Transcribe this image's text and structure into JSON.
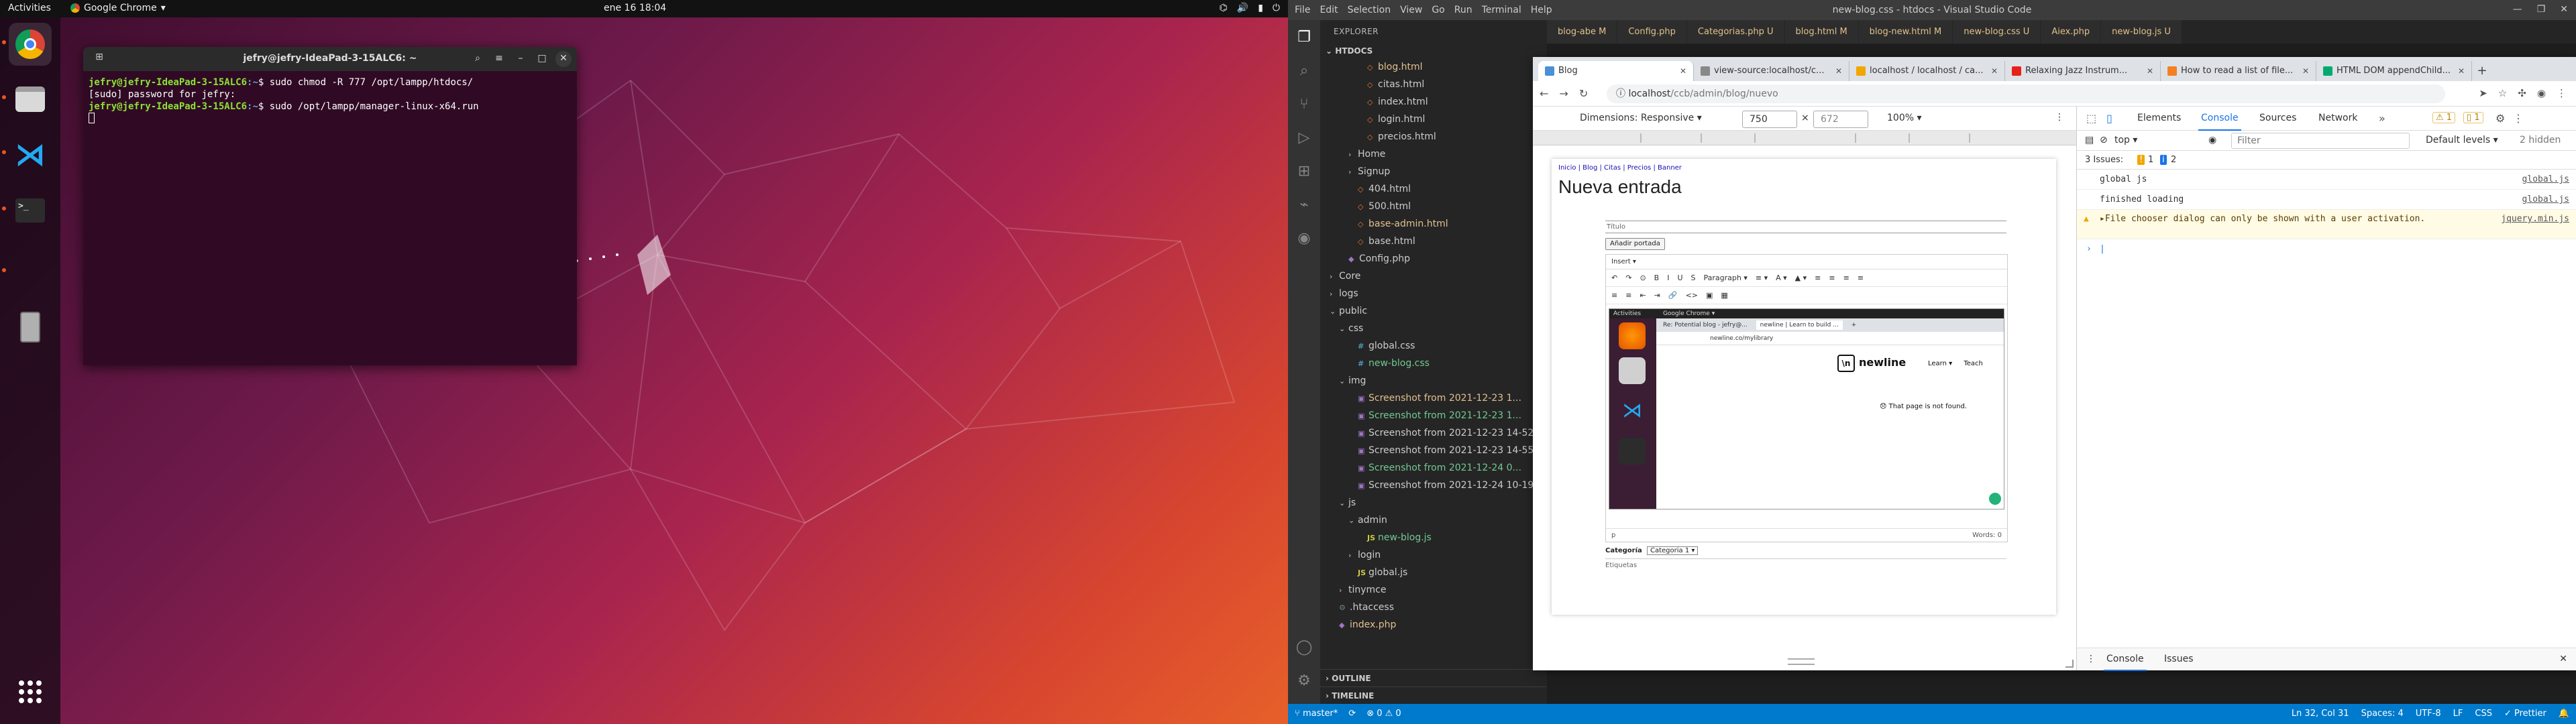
{
  "desktop": {
    "topbar": {
      "activities": "Activities",
      "app_name": "Google Chrome",
      "clock": "ene 16  18:04"
    },
    "terminal": {
      "title": "jefry@jefry-IdeaPad-3-15ALC6: ~",
      "lines": [
        {
          "user": "jefry@jefry-IdeaPad-3-15ALC6",
          "path": ":~",
          "cmd": "$ sudo chmod -R 777 /opt/lampp/htdocs/"
        },
        {
          "plain": "[sudo] password for jefry:"
        },
        {
          "user": "jefry@jefry-IdeaPad-3-15ALC6",
          "path": ":~",
          "cmd": "$ sudo /opt/lampp/manager-linux-x64.run"
        }
      ]
    }
  },
  "vscode": {
    "menu": [
      "File",
      "Edit",
      "Selection",
      "View",
      "Go",
      "Run",
      "Terminal",
      "Help"
    ],
    "window_title": "new-blog.css - htdocs - Visual Studio Code",
    "explorer_header": "EXPLORER",
    "root": "HTDOCS",
    "tree": [
      {
        "name": "blog.html",
        "depth": 3,
        "kind": "html",
        "status": "M",
        "cls": "mod"
      },
      {
        "name": "citas.html",
        "depth": 3,
        "kind": "html"
      },
      {
        "name": "index.html",
        "depth": 3,
        "kind": "html"
      },
      {
        "name": "login.html",
        "depth": 3,
        "kind": "html"
      },
      {
        "name": "precios.html",
        "depth": 3,
        "kind": "html"
      },
      {
        "name": "Home",
        "depth": 2,
        "kind": "folder"
      },
      {
        "name": "Signup",
        "depth": 2,
        "kind": "folder"
      },
      {
        "name": "404.html",
        "depth": 2,
        "kind": "html"
      },
      {
        "name": "500.html",
        "depth": 2,
        "kind": "html"
      },
      {
        "name": "base-admin.html",
        "depth": 2,
        "kind": "html",
        "status": "M",
        "cls": "mod"
      },
      {
        "name": "base.html",
        "depth": 2,
        "kind": "html"
      },
      {
        "name": "Config.php",
        "depth": 1,
        "kind": "php"
      },
      {
        "name": "Core",
        "depth": 0,
        "kind": "folder"
      },
      {
        "name": "logs",
        "depth": 0,
        "kind": "folder"
      },
      {
        "name": "public",
        "depth": 0,
        "kind": "folder-open"
      },
      {
        "name": "css",
        "depth": 1,
        "kind": "folder-open"
      },
      {
        "name": "global.css",
        "depth": 2,
        "kind": "css"
      },
      {
        "name": "new-blog.css",
        "depth": 2,
        "kind": "css",
        "status": "U",
        "cls": "untr"
      },
      {
        "name": "img",
        "depth": 1,
        "kind": "folder-open"
      },
      {
        "name": "Screenshot from 2021-12-23 1...",
        "depth": 2,
        "kind": "img",
        "status": "M",
        "cls": "mod"
      },
      {
        "name": "Screenshot from 2021-12-23 1...",
        "depth": 2,
        "kind": "img",
        "status": "U",
        "cls": "untr"
      },
      {
        "name": "Screenshot from 2021-12-23 14-52-...",
        "depth": 2,
        "kind": "img"
      },
      {
        "name": "Screenshot from 2021-12-23 14-55-...",
        "depth": 2,
        "kind": "img"
      },
      {
        "name": "Screenshot from 2021-12-24 0...",
        "depth": 2,
        "kind": "img",
        "status": "U",
        "cls": "untr"
      },
      {
        "name": "Screenshot from 2021-12-24 10-19-...",
        "depth": 2,
        "kind": "img"
      },
      {
        "name": "js",
        "depth": 1,
        "kind": "folder-open"
      },
      {
        "name": "admin",
        "depth": 2,
        "kind": "folder-open"
      },
      {
        "name": "new-blog.js",
        "depth": 3,
        "kind": "js",
        "status": "U",
        "cls": "untr"
      },
      {
        "name": "login",
        "depth": 2,
        "kind": "folder"
      },
      {
        "name": "global.js",
        "depth": 2,
        "kind": "js"
      },
      {
        "name": "tinymce",
        "depth": 1,
        "kind": "folder"
      },
      {
        "name": ".htaccess",
        "depth": 0,
        "kind": "dot"
      },
      {
        "name": "index.php",
        "depth": 0,
        "kind": "php",
        "status": "M",
        "cls": "mod"
      }
    ],
    "outline": "OUTLINE",
    "timeline": "TIMELINE",
    "editor_tabs": [
      "blog-abe M",
      "Config.php",
      "Categorias.php U",
      "blog.html M",
      "blog-new.html M",
      "new-blog.css U",
      "Aiex.php",
      "new-blog.js U"
    ],
    "status_bar": {
      "branch": "master*",
      "sync": "⟳",
      "problems": "⊗ 0 ⚠ 0",
      "position": "Ln 32, Col 31",
      "spaces": "Spaces: 4",
      "encoding": "UTF-8",
      "eol": "LF",
      "language": "CSS",
      "formatter": "✓ Prettier"
    }
  },
  "chrome": {
    "tabs": [
      {
        "title": "Blog",
        "active": true,
        "fav": "#4a90d9"
      },
      {
        "title": "view-source:localhost/c...",
        "fav": "#888"
      },
      {
        "title": "localhost / localhost / ca...",
        "fav": "#f2a600"
      },
      {
        "title": "Relaxing Jazz Instrum...",
        "fav": "#e62117"
      },
      {
        "title": "How to read a list of file...",
        "fav": "#f48024"
      },
      {
        "title": "HTML DOM appendChild...",
        "fav": "#04aa6d"
      }
    ],
    "url_host": "localhost",
    "url_path": "/ccb/admin/blog/nuevo",
    "device": {
      "dimensions_label": "Dimensions: Responsive ▾",
      "width": "750",
      "height": "672",
      "zoom": "100% ▾"
    },
    "page": {
      "breadcrumbs": "Inicio | Blog | Citas | Precios | Banner",
      "heading": "Nueva entrada",
      "title_label": "Título",
      "cover_button": "Añadir portada",
      "editor_menu": "Insert ▾",
      "editor_toolbar1": [
        "↶",
        "↷",
        "⊙",
        "B",
        "I",
        "U",
        "S",
        "Paragraph ▾",
        "≡ ▾",
        "A ▾",
        "▲ ▾",
        "≡",
        "≡",
        "≡",
        "≡"
      ],
      "editor_toolbar2": [
        "≡",
        "≡",
        "⇤",
        "⇥",
        "🔗",
        "<>",
        "▣",
        "▦"
      ],
      "status_path": "p",
      "words": "Words: 0",
      "category_label": "Categoría",
      "category_value": "Categoria 1 ▾",
      "tags_label": "Etiquetas",
      "shot": {
        "activities": "Activities",
        "app": "Google Chrome ▾",
        "tab1": "Re: Potential blog - jefry@...",
        "tab2": "newline | Learn to build ...",
        "url": "newline.co/mylibrary",
        "brand": "newline",
        "nav": [
          "Learn ▾",
          "Teach"
        ],
        "not_found": "😞 That page is not found."
      }
    },
    "devtools": {
      "tabs": [
        "Elements",
        "Console",
        "Sources",
        "Network"
      ],
      "warn_badge": "⚠ 1",
      "err_badge": "▯ 1",
      "context": "top ▾",
      "filter_placeholder": "Filter",
      "levels": "Default levels ▾",
      "hidden": "2 hidden",
      "issues_label": "3 Issues:",
      "issues_warn": "1",
      "issues_info": "2",
      "logs": [
        {
          "text": "global js",
          "src": "global.js"
        },
        {
          "text": "finished loading",
          "src": "global.js"
        }
      ],
      "warning_text": "▸File chooser dialog can only be shown with a user activation.",
      "warning_src": "jquery.min.js",
      "drawer_tabs": [
        "Console",
        "Issues"
      ]
    }
  },
  "colors": {
    "ubuntu_orange": "#e95420",
    "vscode_blue": "#007acc",
    "devtools_blue": "#1a73e8"
  }
}
